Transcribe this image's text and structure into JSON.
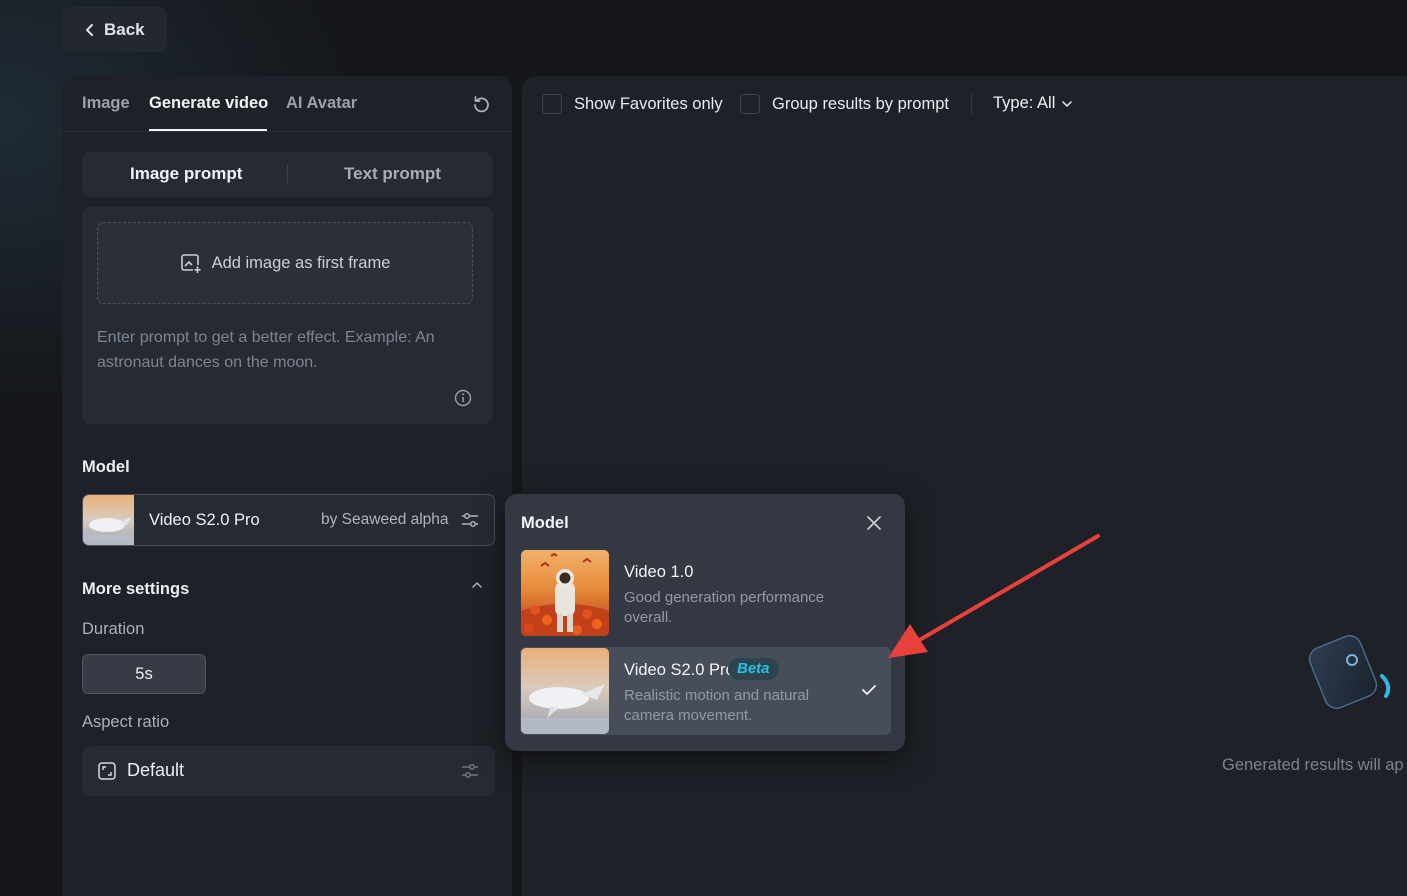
{
  "back_button": {
    "label": "Back"
  },
  "left_panel": {
    "tabs": [
      {
        "label": "Image",
        "active": false
      },
      {
        "label": "Generate video",
        "active": true
      },
      {
        "label": "AI Avatar",
        "active": false
      }
    ],
    "prompt_modes": {
      "image": "Image prompt",
      "text": "Text prompt",
      "selected": "Image prompt"
    },
    "add_image_label": "Add image as first frame",
    "prompt_placeholder": "Enter prompt to get a better effect. Example: An astronaut dances on the moon.",
    "model_section": {
      "title": "Model",
      "selected_name": "Video S2.0 Pro",
      "selected_by": "by Seaweed alpha"
    },
    "more_settings": {
      "title": "More settings",
      "duration_label": "Duration",
      "duration_value": "5s",
      "aspect_ratio_label": "Aspect ratio",
      "aspect_ratio_value": "Default"
    }
  },
  "results_panel": {
    "show_favorites_label": "Show Favorites only",
    "show_favorites_checked": false,
    "group_by_prompt_label": "Group results by prompt",
    "group_by_prompt_checked": false,
    "type_filter_label": "Type: All",
    "empty_state_text": "Generated results will ap"
  },
  "model_popup": {
    "title": "Model",
    "options": [
      {
        "name": "Video 1.0",
        "description": "Good generation performance overall.",
        "badge": "",
        "selected": false
      },
      {
        "name": "Video S2.0 Pro",
        "description": "Realistic motion and natural camera movement.",
        "badge": "Beta",
        "selected": true
      }
    ]
  },
  "colors": {
    "background": "#15171b",
    "panel": "#1e2127",
    "popup": "#333842",
    "selected_option": "#474d59",
    "beta_text": "#27c1e6",
    "annotation_arrow": "#e8403a"
  }
}
